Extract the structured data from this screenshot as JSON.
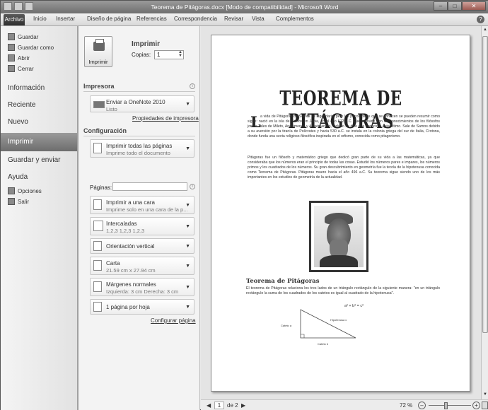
{
  "window": {
    "title": "Teorema de Pitágoras.docx [Modo de compatibilidad] - Microsoft Word",
    "controls": {
      "minimize": "–",
      "maximize": "□",
      "close": "✕"
    }
  },
  "ribbon": {
    "file_tab": "Archivo",
    "tabs": [
      "Inicio",
      "Insertar",
      "Diseño de página",
      "Referencias",
      "Correspondencia",
      "Revisar",
      "Vista",
      "Complementos"
    ],
    "help": "?"
  },
  "backstage": {
    "commands": [
      "Guardar",
      "Guardar como",
      "Abrir",
      "Cerrar"
    ],
    "sections": [
      "Información",
      "Reciente",
      "Nuevo",
      "Imprimir",
      "Guardar y enviar",
      "Ayuda"
    ],
    "selected": "Imprimir",
    "bottom_commands": [
      "Opciones",
      "Salir"
    ]
  },
  "print": {
    "heading": "Imprimir",
    "button_label": "Imprimir",
    "copies_label": "Copias:",
    "copies_value": "1",
    "printer_heading": "Impresora",
    "printer_name": "Enviar a OneNote 2010",
    "printer_status": "Listo",
    "printer_properties_link": "Propiedades de impresora",
    "settings_heading": "Configuración",
    "settings": [
      {
        "title": "Imprimir todas las páginas",
        "detail": "Imprime todo el documento"
      },
      {
        "title": "Imprimir a una cara",
        "detail": "Imprime solo en una cara de la p..."
      },
      {
        "title": "Intercaladas",
        "detail": "1,2,3   1,2,3   1,2,3"
      },
      {
        "title": "Orientación vertical",
        "detail": ""
      },
      {
        "title": "Carta",
        "detail": "21.59 cm x 27.94 cm"
      },
      {
        "title": "Márgenes normales",
        "detail": "Izquierda: 3 cm   Derecha: 3 cm"
      },
      {
        "title": "1 página por hoja",
        "detail": ""
      }
    ],
    "pages_label": "Páginas:",
    "pages_value": "",
    "page_setup_link": "Configurar página"
  },
  "document": {
    "title": "TEOREMA DE PITÁGORAS",
    "dropcap": "L",
    "paragraph1": "a vida de Pitágoras de Samos es legendaria, pero los pocos datos que se conocen se pueden resumir como sigue: nació en la isla de Samos en Jonia, en el año 572 a.C. Fue instruido con los conocimientos de los filósofos jonios Tales de Mileto, Anaximenes y Anaximandro, incluso se dice que conoció a este último. Sale de Samos debido a su aversión por la tiranía de Polícrates y hacia 530 a.C. se instala en la colonia griega del sur de Italia, Crotona, donde funda una secta religioso-filosófica inspirada en el orfismo, conocida como pitagorismo.",
    "paragraph2": "Pitágoras fue un filósofo y matemático griego que dedicó gran parte de su vida a las matemáticas, ya que consideraba que los números eran el principio de todas las cosas. Estudió los números pares e impares, los números primos y los cuadrados de los números. Su gran descubrimiento en geometría fue la teoría de la hipotenusa conocida como Teorema de Pitágoras. Pitágoras muere hacia el año 496 a.C. Su teorema sigue siendo uno de los más importantes en los estudios de geometría de la actualidad.",
    "section_title": "Teorema de Pitágoras",
    "section_text": "El teorema de Pitágoras relaciona los tres lados de un triángulo rectángulo de la siguiente manera: \"en un triángulo rectángulo la suma de los cuadrados de los catetos es igual al cuadrado de la hipotenusa\".",
    "formula": "a² + b² = c²",
    "cateto_a": "Cateto a",
    "hipotenusa": "Hipotenusa c",
    "cateto_b": "Cateto b"
  },
  "status": {
    "page_current": "1",
    "page_total": "de 2",
    "zoom": "72 %"
  }
}
